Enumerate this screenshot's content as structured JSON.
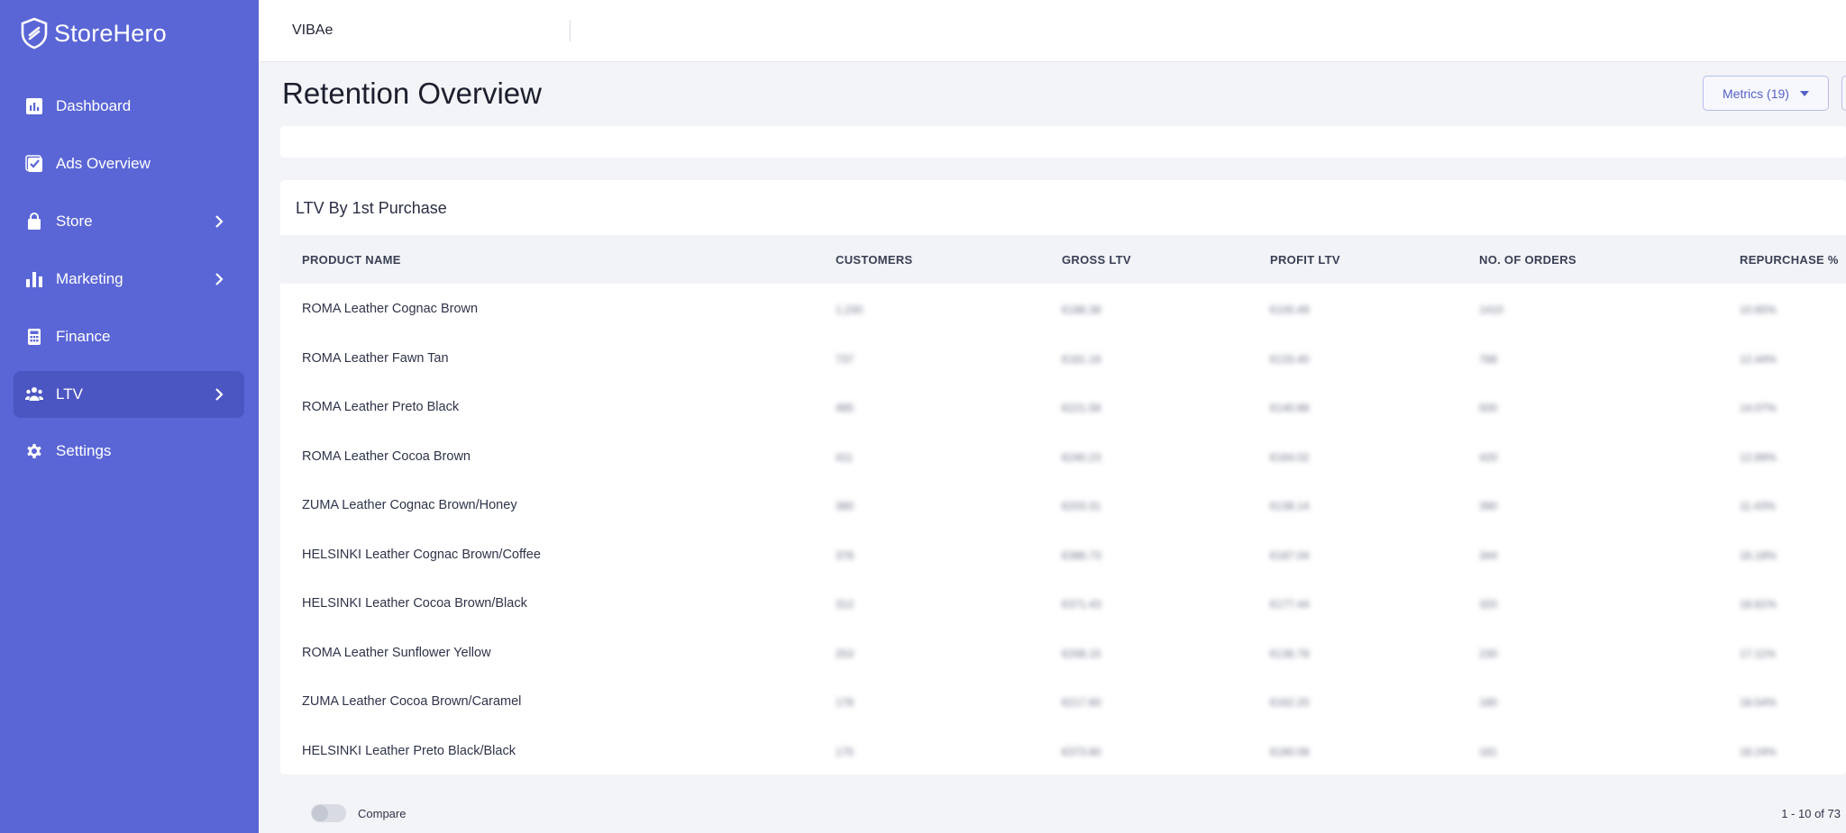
{
  "brand": {
    "name": "StoreHero"
  },
  "sidebar": {
    "items": [
      {
        "label": "Dashboard",
        "icon": "bar-chart-icon",
        "chevron": false,
        "active": false
      },
      {
        "label": "Ads Overview",
        "icon": "checklist-icon",
        "chevron": false,
        "active": false
      },
      {
        "label": "Store",
        "icon": "shopping-bag-icon",
        "chevron": true,
        "active": false
      },
      {
        "label": "Marketing",
        "icon": "marketing-bars-icon",
        "chevron": true,
        "active": false
      },
      {
        "label": "Finance",
        "icon": "calculator-icon",
        "chevron": false,
        "active": false
      },
      {
        "label": "LTV",
        "icon": "users-icon",
        "chevron": true,
        "active": true
      },
      {
        "label": "Settings",
        "icon": "gear-icon",
        "chevron": false,
        "active": false
      }
    ]
  },
  "topbar": {
    "store_name": "VIBAe"
  },
  "page": {
    "title": "Retention Overview",
    "metrics_button": "Metrics (19)"
  },
  "table": {
    "title": "LTV By 1st Purchase",
    "columns": [
      "PRODUCT NAME",
      "CUSTOMERS",
      "GROSS LTV",
      "PROFIT LTV",
      "NO. OF ORDERS",
      "REPURCHASE %"
    ],
    "rows": [
      [
        "ROMA Leather Cognac Brown",
        "1,230",
        "€188.38",
        "€100.49",
        "1410",
        "10.65%"
      ],
      [
        "ROMA Leather Fawn Tan",
        "737",
        "€181.16",
        "€133.40",
        "788",
        "12.44%"
      ],
      [
        "ROMA Leather Preto Black",
        "485",
        "€221.58",
        "€140.88",
        "500",
        "14.07%"
      ],
      [
        "ROMA Leather Cocoa Brown",
        "411",
        "€240.23",
        "€164.02",
        "420",
        "12.89%"
      ],
      [
        "ZUMA Leather Cognac Brown/Honey",
        "380",
        "€203.31",
        "€138.14",
        "390",
        "11.43%"
      ],
      [
        "HELSINKI Leather Cognac Brown/Coffee",
        "378",
        "€386.73",
        "€187.04",
        "344",
        "16.18%"
      ],
      [
        "HELSINKI Leather Cocoa Brown/Black",
        "312",
        "€371.43",
        "€177.44",
        "320",
        "18.81%"
      ],
      [
        "ROMA Leather Sunflower Yellow",
        "253",
        "€208.15",
        "€136.78",
        "230",
        "17.11%"
      ],
      [
        "ZUMA Leather Cocoa Brown/Caramel",
        "178",
        "€217.60",
        "€162.20",
        "180",
        "18.54%"
      ],
      [
        "HELSINKI Leather Preto Black/Black",
        "175",
        "€373.80",
        "€180.08",
        "181",
        "18.24%"
      ]
    ]
  },
  "footer": {
    "compare_label": "Compare",
    "pagination": "1 - 10 of 73"
  }
}
